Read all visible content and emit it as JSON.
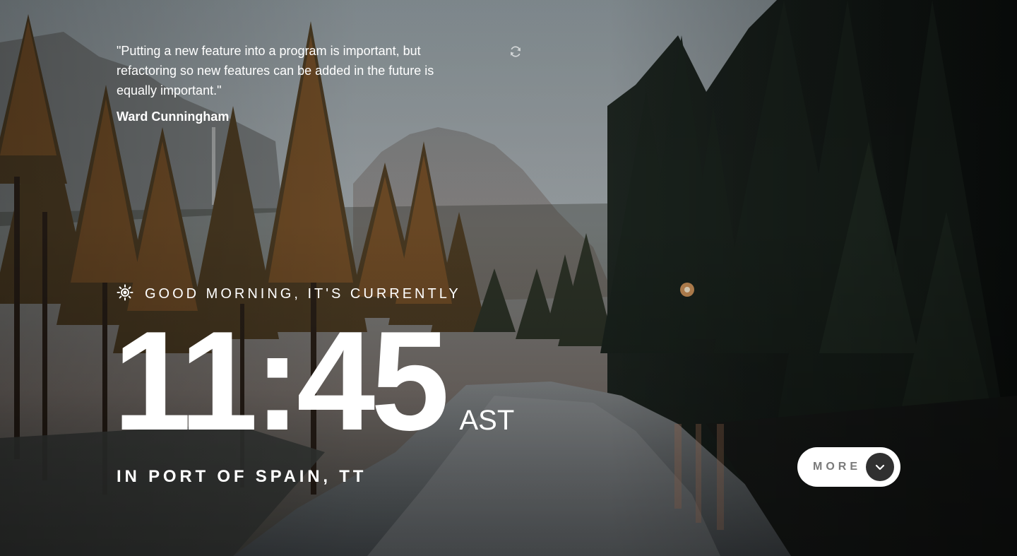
{
  "quote": {
    "text": "\"Putting a new feature into a program is important, but refactoring so new features can be added in the future is equally important.\"",
    "author": "Ward Cunningham",
    "refresh_icon": "refresh-icon"
  },
  "greeting": {
    "icon": "sun-icon",
    "text": "GOOD MORNING, IT'S CURRENTLY"
  },
  "clock": {
    "time": "11:45",
    "timezone": "AST"
  },
  "location": {
    "text": "IN PORT OF SPAIN, TT"
  },
  "more_button": {
    "label": "MORE",
    "icon": "chevron-down-icon"
  },
  "colors": {
    "text": "#ffffff",
    "button_bg": "#ffffff",
    "button_label": "#7a7a7a",
    "button_icon_bg": "#303030"
  }
}
